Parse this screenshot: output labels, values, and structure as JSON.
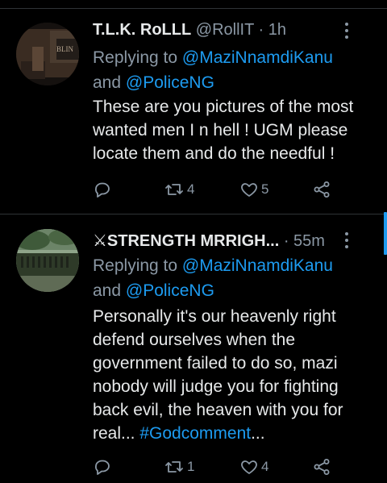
{
  "tweets": [
    {
      "display_name": "T.L.K. RoLLL",
      "handle": "@RollIT",
      "time": "· 1h",
      "replying_to": "Replying to",
      "mention1": "@MaziNnamdiKanu",
      "and": "and",
      "mention2": "@PoliceNG",
      "text": "These are you pictures of the most wanted men I n hell ! UGM please locate them and do the needful !",
      "avatar_text": "BLIN",
      "counts": {
        "replies": "",
        "retweets": "4",
        "likes": "5"
      }
    },
    {
      "display_name": "⚔STRENGTH MRRIGH...",
      "handle": "",
      "time": "· 55m",
      "replying_to": "Replying to",
      "mention1": "@MaziNnamdiKanu",
      "and": "and",
      "mention2": "@PoliceNG",
      "text": "Personally it's our heavenly right defend ourselves when the government failed to do so, mazi nobody will judge you for fighting back evil, the heaven with you for real... ",
      "hashtag": "#Godcomment",
      "ellipsis": "...",
      "counts": {
        "replies": "",
        "retweets": "1",
        "likes": "4"
      }
    }
  ],
  "icons": [
    "reply-icon",
    "retweet-icon",
    "like-icon",
    "share-icon",
    "more-icon"
  ],
  "colors": {
    "link": "#1d9bf0",
    "muted": "#8b98a5",
    "background": "#000000",
    "text": "#e7e9ea"
  }
}
